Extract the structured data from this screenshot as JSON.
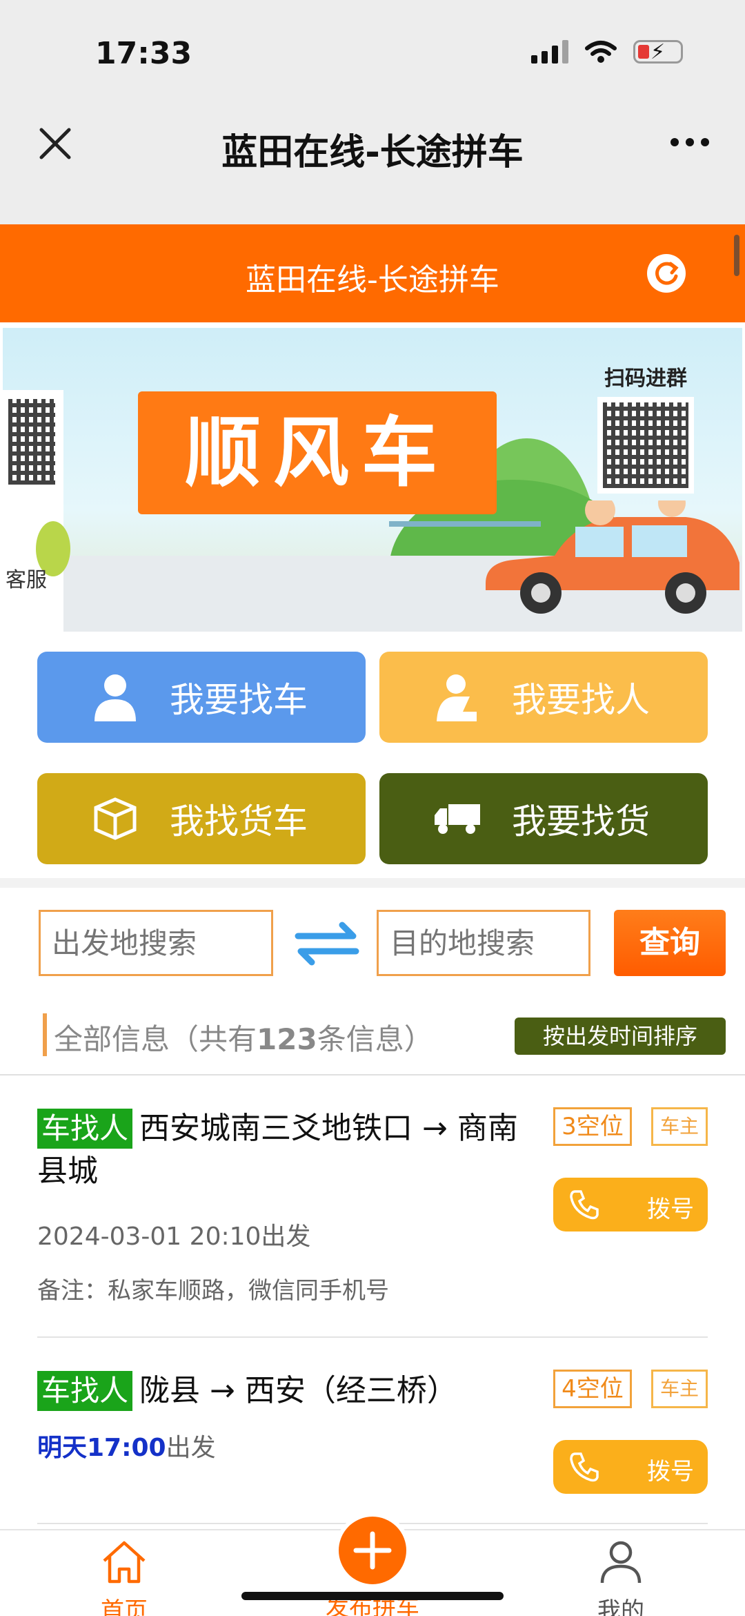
{
  "status_bar": {
    "time": "17:33"
  },
  "wechat_nav": {
    "title": "蓝田在线-长途拼车"
  },
  "page_header": {
    "title": "蓝田在线-长途拼车"
  },
  "banner": {
    "sign_text": "顺风车",
    "qr_caption": "扫码进群",
    "service_label": "客服"
  },
  "actions": [
    {
      "label": "我要找车",
      "icon": "person-icon",
      "color": "#5b99ec"
    },
    {
      "label": "我要找人",
      "icon": "driver-icon",
      "color": "#fbbd4b"
    },
    {
      "label": "我找货车",
      "icon": "box-icon",
      "color": "#d1aa17"
    },
    {
      "label": "我要找货",
      "icon": "truck-icon",
      "color": "#4a5e13"
    }
  ],
  "search": {
    "from_placeholder": "出发地搜索",
    "to_placeholder": "目的地搜索",
    "query_label": "查询"
  },
  "list_header": {
    "prefix": "全部信息（共有",
    "count": "123",
    "suffix": "条信息）",
    "sort_label": "按出发时间排序"
  },
  "listings": [
    {
      "tag": "车找人",
      "route": "西安城南三爻地铁口 → 商南县城",
      "depart_highlight": "",
      "depart": "2024-03-01 20:10出发",
      "note": "备注：私家车顺路，微信同手机号",
      "seats": "3空位",
      "owner": "车主",
      "dial": "拨号"
    },
    {
      "tag": "车找人",
      "route": "陇县 → 西安（经三桥）",
      "depart_highlight": "明天17:00",
      "depart": "出发",
      "note": "",
      "seats": "4空位",
      "owner": "车主",
      "dial": "拨号"
    }
  ],
  "tabbar": {
    "home": "首页",
    "publish": "发布拼车",
    "me": "我的"
  },
  "colors": {
    "brand_orange": "#ff6a00",
    "tag_green": "#1aa41a",
    "dark_olive": "#4a5e13"
  }
}
